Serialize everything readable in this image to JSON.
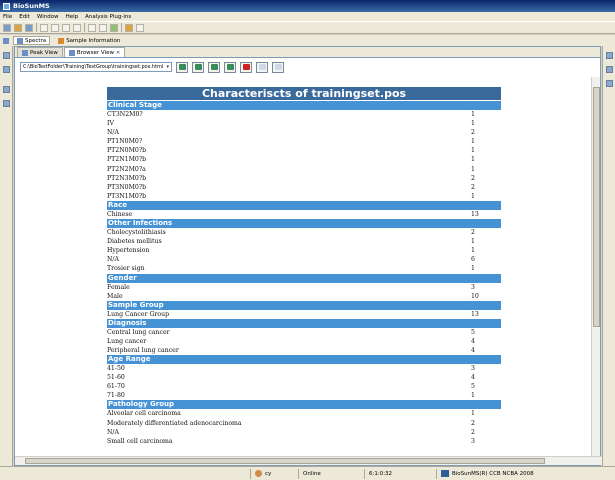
{
  "window": {
    "title": "BioSunMS"
  },
  "menu": [
    "File",
    "Edit",
    "Window",
    "Help",
    "Analysis Plug-ins"
  ],
  "perspectives": [
    {
      "label": "Spectra"
    },
    {
      "label": "Sample Information"
    }
  ],
  "editor_tabs": [
    {
      "label": "Peak View"
    },
    {
      "label": "Browser View"
    }
  ],
  "browser": {
    "url": "C:\\BioTestFolder\\Training\\TestGroup\\trainingset.pos.html"
  },
  "report": {
    "title": "Characteriscts of trainingset.pos",
    "sections": [
      {
        "name": "Clinical Stage",
        "rows": [
          {
            "label": "CT3N2M0?",
            "value": "1"
          },
          {
            "label": "IV",
            "value": "1"
          },
          {
            "label": "N/A",
            "value": "2"
          },
          {
            "label": "PT1N0M0?",
            "value": "1"
          },
          {
            "label": "PT2N0M0?b",
            "value": "1"
          },
          {
            "label": "PT2N1M0?b",
            "value": "1"
          },
          {
            "label": "PT2N2M0?a",
            "value": "1"
          },
          {
            "label": "PT2N3M0?b",
            "value": "2"
          },
          {
            "label": "PT3N0M0?b",
            "value": "2"
          },
          {
            "label": "PT3N1M0?b",
            "value": "1"
          }
        ]
      },
      {
        "name": "Race",
        "rows": [
          {
            "label": "Chinese",
            "value": "13"
          }
        ]
      },
      {
        "name": "Other Infections",
        "rows": [
          {
            "label": "Cholecystolithiasis",
            "value": "2"
          },
          {
            "label": "Diabetes mellitus",
            "value": "1"
          },
          {
            "label": "Hypertension",
            "value": "1"
          },
          {
            "label": "N/A",
            "value": "6"
          },
          {
            "label": "Trosier sign",
            "value": "1"
          }
        ]
      },
      {
        "name": "Gender",
        "rows": [
          {
            "label": "Female",
            "value": "3"
          },
          {
            "label": "Male",
            "value": "10"
          }
        ]
      },
      {
        "name": "Sample Group",
        "rows": [
          {
            "label": "Lung Cancer Group",
            "value": "13"
          }
        ]
      },
      {
        "name": "Diagnosis",
        "rows": [
          {
            "label": "Central lung cancer",
            "value": "5"
          },
          {
            "label": "Lung cancer",
            "value": "4"
          },
          {
            "label": "Peripheral lung cancer",
            "value": "4"
          }
        ]
      },
      {
        "name": "Age Range",
        "rows": [
          {
            "label": "41-50",
            "value": "3"
          },
          {
            "label": "51-60",
            "value": "4"
          },
          {
            "label": "61-70",
            "value": "5"
          },
          {
            "label": "71-80",
            "value": "1"
          }
        ]
      },
      {
        "name": "Pathology Group",
        "rows": [
          {
            "label": "Alveolar cell carcinoma",
            "value": "1"
          },
          {
            "label": "Moderately differentiated adenocarcinoma",
            "value": "2"
          },
          {
            "label": "N/A",
            "value": "2"
          },
          {
            "label": "Small cell carcinoma",
            "value": "3"
          }
        ]
      }
    ]
  },
  "status": {
    "user": "cy",
    "connection": "Online",
    "clock": "6:1:0:32",
    "app": "BioSunMS(R) CCB NCBA 2008"
  },
  "colors": {
    "title_band": "#3a6a9c",
    "section_band": "#4593d4"
  }
}
